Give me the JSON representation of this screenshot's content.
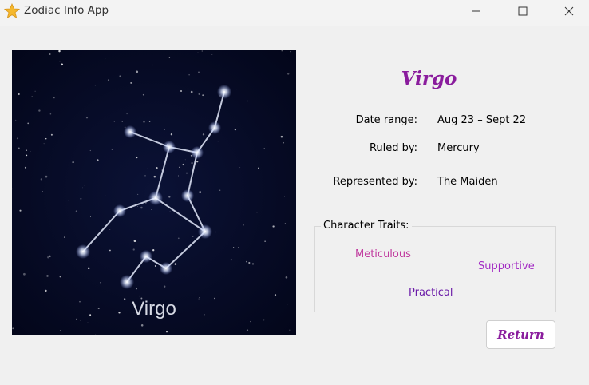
{
  "window": {
    "title": "Zodiac Info App",
    "icon": "star-icon",
    "controls": [
      "minimize-icon",
      "maximize-icon",
      "close-icon"
    ]
  },
  "image": {
    "caption": "Virgo"
  },
  "sign": {
    "name": "Virgo",
    "accent_color": "#8a1c9d"
  },
  "info": {
    "date_range_label": "Date range:",
    "date_range_value": "Aug 23 – Sept 22",
    "ruled_by_label": "Ruled by:",
    "ruled_by_value": "Mercury",
    "represented_by_label": "Represented by:",
    "represented_by_value": "The Maiden"
  },
  "traits": {
    "legend": "Character Traits:",
    "items": [
      {
        "label": "Meticulous",
        "color": "#c0399e"
      },
      {
        "label": "Supportive",
        "color": "#a32bc4"
      },
      {
        "label": "Practical",
        "color": "#6a1aa8"
      }
    ]
  },
  "buttons": {
    "return_label": "Return"
  }
}
